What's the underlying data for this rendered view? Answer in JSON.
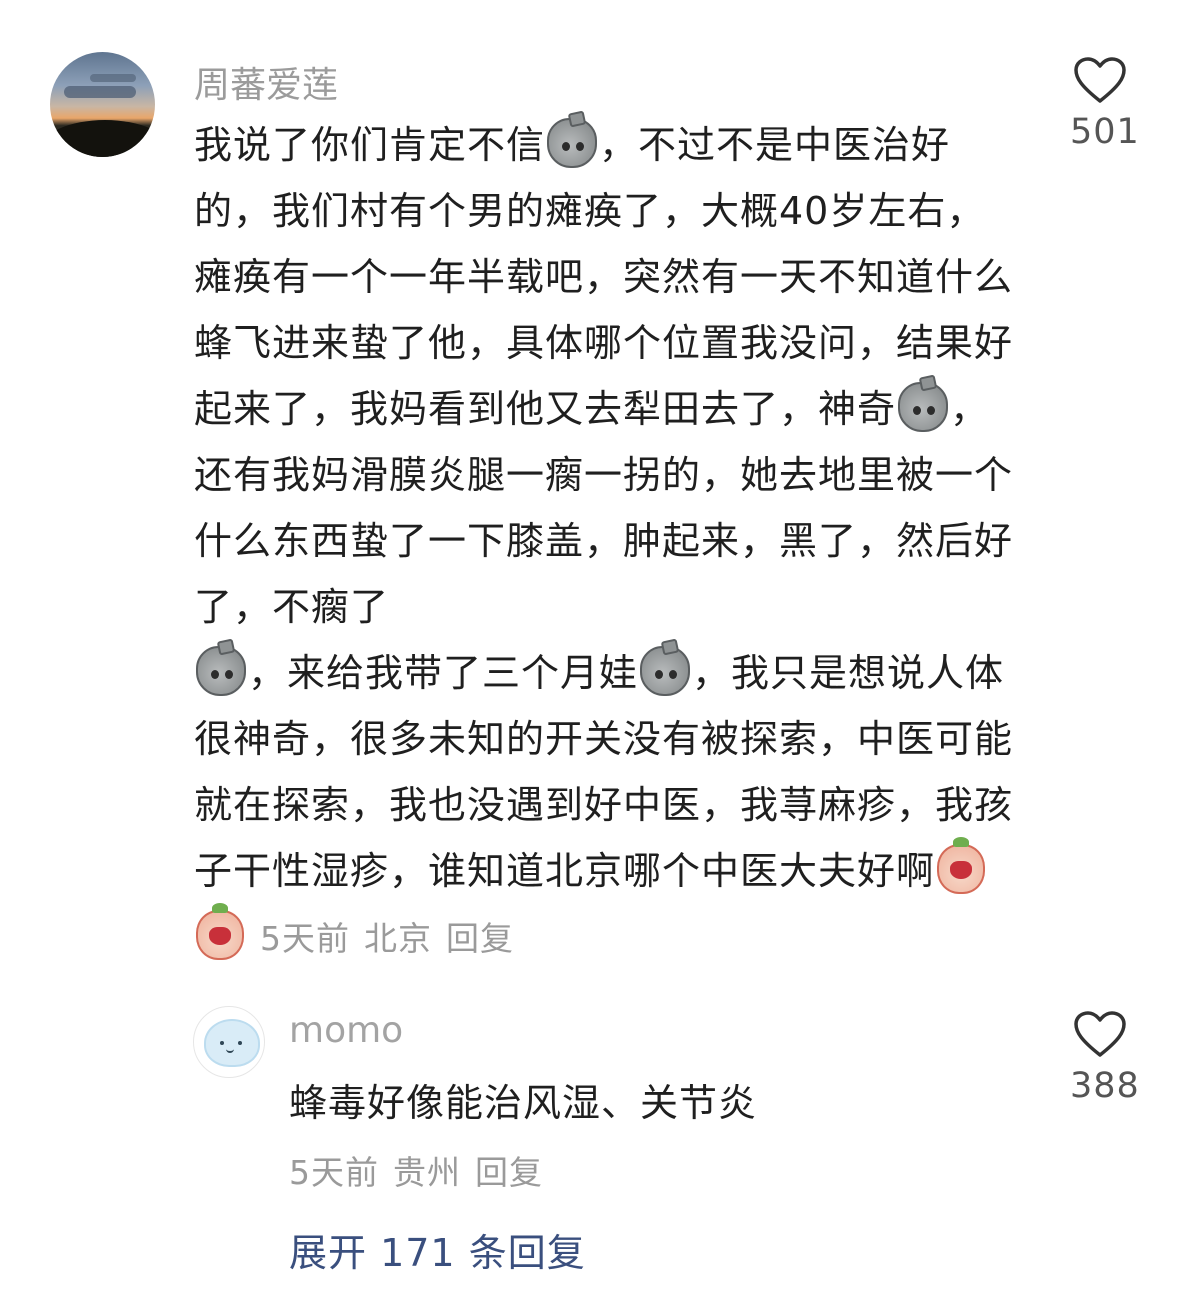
{
  "comment1": {
    "username": "周蕃爱莲",
    "text_part1": "我说了你们肯定不信",
    "text_part2": "，不过不是中医治好的，我们村有个男的瘫痪了，大概40岁左右，瘫痪有一个一年半载吧，突然有一天不知道什么蜂飞进来蛰了他，具体哪个位置我没问，结果好起来了，我妈看到他又去犁田去了，神奇",
    "text_part3": "，还有我妈滑膜炎腿一瘸一拐的，她去地里被一个什么东西蛰了一下膝盖，肿起来，黑了，然后好了，不瘸了",
    "text_part4": "，来给我带了三个月娃",
    "text_part5": "，我只是想说人体很神奇，很多未知的开关没有被探索，中医可能就在探索，我也没遇到好中医，我荨麻疹，我孩子干性湿疹，谁知道北京哪个中医大夫好啊",
    "time": "5天前",
    "location": "北京",
    "reply_label": "回复",
    "likes": "501"
  },
  "comment2": {
    "username": "momo",
    "text": "蜂毒好像能治风湿、关节炎",
    "time": "5天前",
    "location": "贵州",
    "reply_label": "回复",
    "likes": "388"
  },
  "expand_label": "展开 171 条回复"
}
